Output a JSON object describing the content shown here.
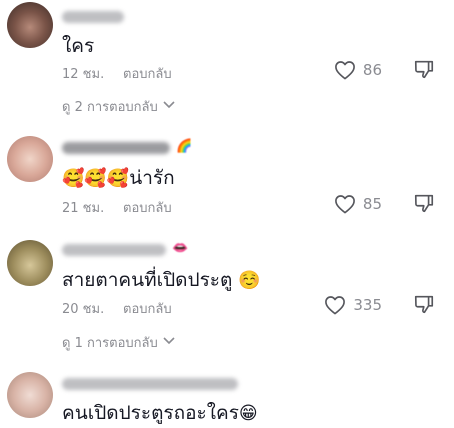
{
  "comments": [
    {
      "text": "ใคร",
      "time": "12 ชม.",
      "reply_label": "ตอบกลับ",
      "likes": "86",
      "view_replies": "ดู 2 การตอบกลับ"
    },
    {
      "emojis": "🥰🥰🥰",
      "text": "น่ารัก",
      "name_emoji": "🌈",
      "time": "21 ชม.",
      "reply_label": "ตอบกลับ",
      "likes": "85"
    },
    {
      "text": "สายตาคนที่เปิดประตู",
      "trailing_emoji": "☺️",
      "name_emoji": "👄",
      "time": "20 ชม.",
      "reply_label": "ตอบกลับ",
      "likes": "335",
      "view_replies": "ดู 1 การตอบกลับ"
    },
    {
      "text": "คนเปิดประตูรถอะใคร",
      "trailing_emoji": "😁"
    }
  ],
  "icons": {
    "like": "heart-outline-icon",
    "dislike": "thumbs-down-icon",
    "expand": "chevron-down-icon"
  },
  "colors": {
    "text": "#161823",
    "muted": "#8a8b91"
  }
}
